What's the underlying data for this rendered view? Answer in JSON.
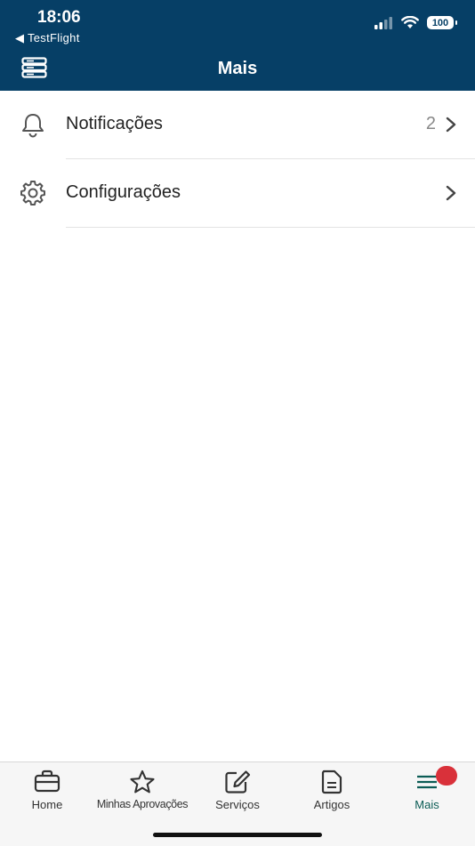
{
  "status_bar": {
    "time": "18:06",
    "back_label": "◀ TestFlight",
    "battery": "100"
  },
  "header": {
    "title": "Mais",
    "menu_icon": "server-list-icon",
    "background_color": "#063f66"
  },
  "list": [
    {
      "label": "Notificações",
      "count": "2",
      "icon": "bell-icon"
    },
    {
      "label": "Configurações",
      "count": "",
      "icon": "gear-icon"
    }
  ],
  "tabbar": {
    "tabs": [
      {
        "label": "Home",
        "icon": "briefcase-icon",
        "active": false
      },
      {
        "label": "Minhas Aprovações",
        "icon": "star-icon",
        "active": false
      },
      {
        "label": "Serviços",
        "icon": "edit-icon",
        "active": false
      },
      {
        "label": "Artigos",
        "icon": "document-icon",
        "active": false
      },
      {
        "label": "Mais",
        "icon": "menu-icon",
        "active": true
      }
    ],
    "active_color": "#0b5c55",
    "badge_color": "#d9313a"
  }
}
